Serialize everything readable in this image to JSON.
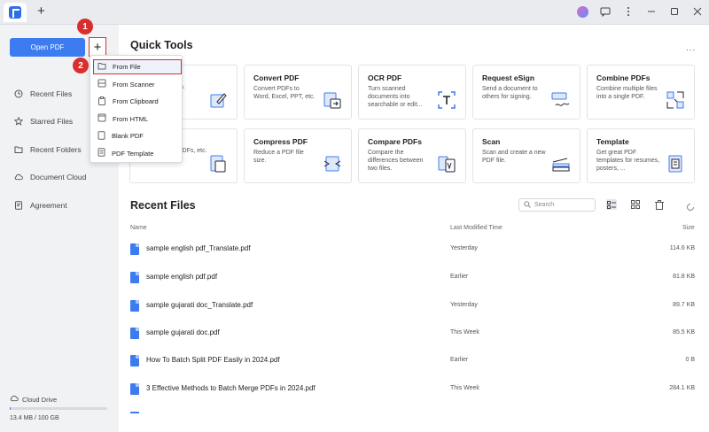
{
  "titlebar": {
    "new_tab_label": "+",
    "icons": [
      "avatar-icon",
      "chat-icon",
      "more-icon",
      "minimize-icon",
      "maximize-icon",
      "close-icon"
    ]
  },
  "sidebar": {
    "open_pdf_label": "Open PDF",
    "plus_label": "+",
    "items": [
      {
        "label": "Recent Files",
        "icon": "clock-icon"
      },
      {
        "label": "Starred Files",
        "icon": "star-icon"
      },
      {
        "label": "Recent Folders",
        "icon": "folder-icon"
      },
      {
        "label": "Document Cloud",
        "icon": "cloud-icon"
      },
      {
        "label": "Agreement",
        "icon": "agreement-icon"
      }
    ],
    "cloud_drive_label": "Cloud Drive",
    "storage_text": "13.4 MB / 100 GB",
    "storage_used_fraction": 0.0001
  },
  "dropdown": {
    "items": [
      {
        "label": "From File",
        "icon": "folder-icon",
        "highlighted": true
      },
      {
        "label": "From Scanner",
        "icon": "scanner-icon"
      },
      {
        "label": "From Clipboard",
        "icon": "clipboard-icon"
      },
      {
        "label": "From HTML",
        "icon": "html-icon"
      },
      {
        "label": "Blank PDF",
        "icon": "blank-page-icon"
      },
      {
        "label": "PDF Template",
        "icon": "template-icon"
      }
    ]
  },
  "badges": {
    "one": "1",
    "two": "2"
  },
  "quick_tools": {
    "title": "Quick Tools",
    "more_label": "...",
    "cards": [
      {
        "title": "",
        "desc": "n.",
        "icon": "edit-icon"
      },
      {
        "title": "Convert PDF",
        "desc": "Convert PDFs to Word, Excel, PPT, etc.",
        "icon": "convert-icon"
      },
      {
        "title": "OCR PDF",
        "desc": "Turn scanned documents into searchable or edit...",
        "icon": "ocr-icon"
      },
      {
        "title": "Request eSign",
        "desc": "Send a document to others for signing.",
        "icon": "esign-icon"
      },
      {
        "title": "Combine PDFs",
        "desc": "Combine multiple files into a single PDF.",
        "icon": "combine-icon"
      },
      {
        "title": "",
        "desc": "...CR PDFs, etc.",
        "icon": "pdf-to-image-icon"
      },
      {
        "title": "Compress PDF",
        "desc": "Reduce a PDF file size.",
        "icon": "compress-icon"
      },
      {
        "title": "Compare PDFs",
        "desc": "Compare the differences between two files.",
        "icon": "compare-icon"
      },
      {
        "title": "Scan",
        "desc": "Scan and create a new PDF file.",
        "icon": "scan-icon"
      },
      {
        "title": "Template",
        "desc": "Get great PDF templates for resumes, posters, ...",
        "icon": "template-icon"
      }
    ]
  },
  "recent": {
    "title": "Recent Files",
    "search_placeholder": "Search",
    "columns": {
      "name": "Name",
      "time": "Last Modified Time",
      "size": "Size"
    },
    "files": [
      {
        "name": "sample english pdf_Translate.pdf",
        "time": "Yesterday",
        "size": "114.6 KB"
      },
      {
        "name": "sample english pdf.pdf",
        "time": "Earlier",
        "size": "81.8 KB"
      },
      {
        "name": "sample gujarati doc_Translate.pdf",
        "time": "Yesterday",
        "size": "89.7 KB"
      },
      {
        "name": "sample gujarati doc.pdf",
        "time": "This Week",
        "size": "85.5 KB"
      },
      {
        "name": "How To Batch Split PDF Easily in 2024.pdf",
        "time": "Earlier",
        "size": "0 B"
      },
      {
        "name": "3 Effective Methods to Batch Merge PDFs in 2024.pdf",
        "time": "This Week",
        "size": "284.1 KB"
      }
    ]
  },
  "colors": {
    "accent": "#3c7cf0",
    "highlight_red": "#d92e2e",
    "sidebar_bg": "#f1f2f4"
  }
}
